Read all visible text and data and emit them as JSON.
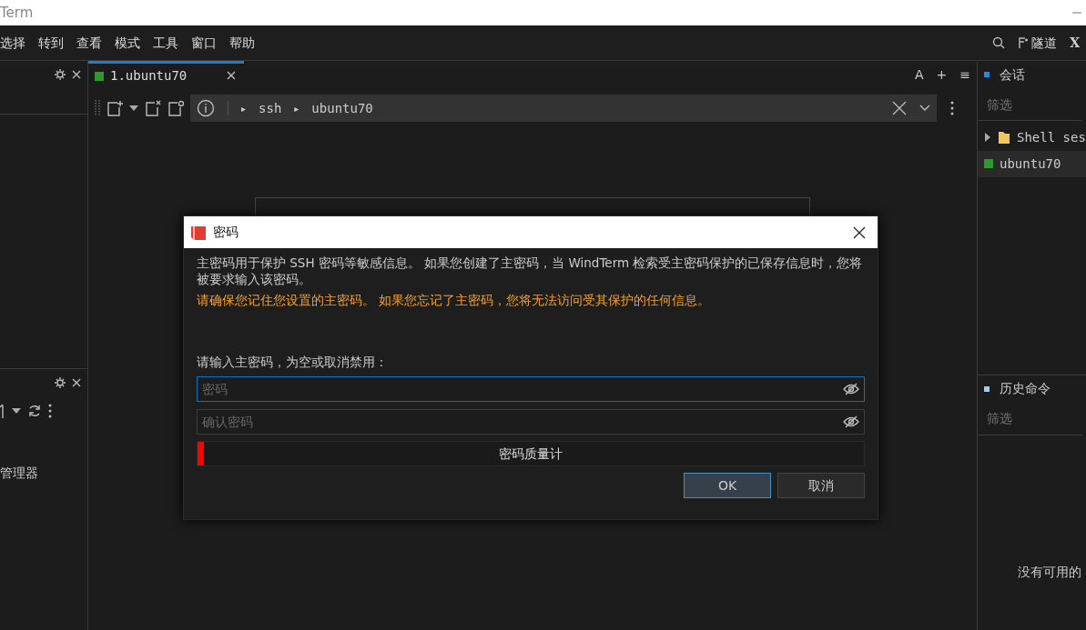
{
  "window": {
    "title": "Term"
  },
  "menu": [
    "选择",
    "转到",
    "查看",
    "模式",
    "工具",
    "窗口",
    "帮助"
  ],
  "menu_right": {
    "tunnel": "隧道",
    "close_label": "X"
  },
  "left_panel": {
    "manager_label": "管理器"
  },
  "tabs": [
    {
      "label": "1.ubuntu70",
      "selected": true,
      "color": "#2e9a2e"
    }
  ],
  "tab_actions": [
    "A",
    "+",
    "≡"
  ],
  "address_bar": {
    "path": [
      {
        "separator": "▸",
        "label": "ssh"
      },
      {
        "separator": "▸",
        "label": "ubuntu70"
      }
    ]
  },
  "sessions_panel": {
    "title": "会话",
    "filter": {
      "placeholder": "筛选"
    },
    "tree": [
      {
        "kind": "folder",
        "label": "Shell ses",
        "expanded": false,
        "selected": false
      },
      {
        "kind": "session",
        "label": "ubuntu70",
        "selected": true,
        "color": "#2e9a2e"
      }
    ]
  },
  "history_panel": {
    "title": "历史命令",
    "filter": {
      "placeholder": "筛选"
    },
    "empty_text": "没有可用的"
  },
  "dialog": {
    "title": "密码",
    "info": "主密码用于保护 SSH 密码等敏感信息。 如果您创建了主密码，当 WindTerm 检索受主密码保护的已保存信息时，您将被要求输入该密码。",
    "warning": "请确保您记住您设置的主密码。 如果您忘记了主密码，您将无法访问受其保护的任何信息。",
    "prompt": "请输入主密码，为空或取消禁用：",
    "fields": [
      {
        "placeholder": "密码",
        "focused": true
      },
      {
        "placeholder": "确认密码",
        "focused": false
      }
    ],
    "meter": {
      "label": "密码质量计",
      "level": 0.01
    },
    "buttons": [
      {
        "label": "OK",
        "default": true
      },
      {
        "label": "取消",
        "default": false
      }
    ]
  }
}
